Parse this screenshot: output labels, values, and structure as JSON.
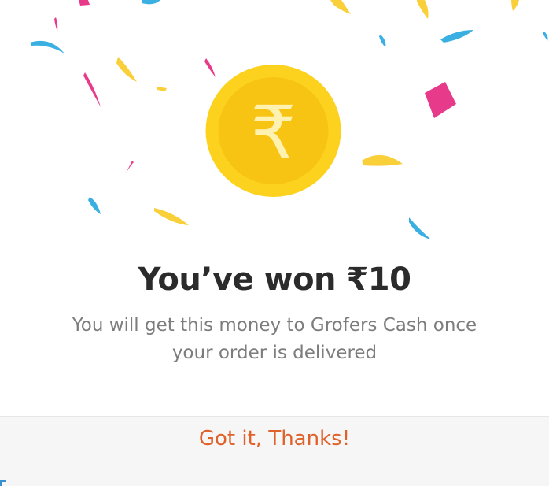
{
  "dialog": {
    "title": "You’ve won ₹10",
    "message": "You will get this money to Grofers Cash once your order is delivered",
    "button_label": "Got it, Thanks!"
  },
  "coin": {
    "symbol": "₹",
    "outer_color": "#fdd21f",
    "inner_color": "#f8c414",
    "symbol_color": "#fff1b0"
  },
  "colors": {
    "accent": "#e0622b",
    "title": "#2b2b2b",
    "message": "#7d7d7d",
    "confetti_blue": "#3ab0e2",
    "confetti_pink": "#e83a8a",
    "confetti_yellow": "#f9cf3a"
  }
}
